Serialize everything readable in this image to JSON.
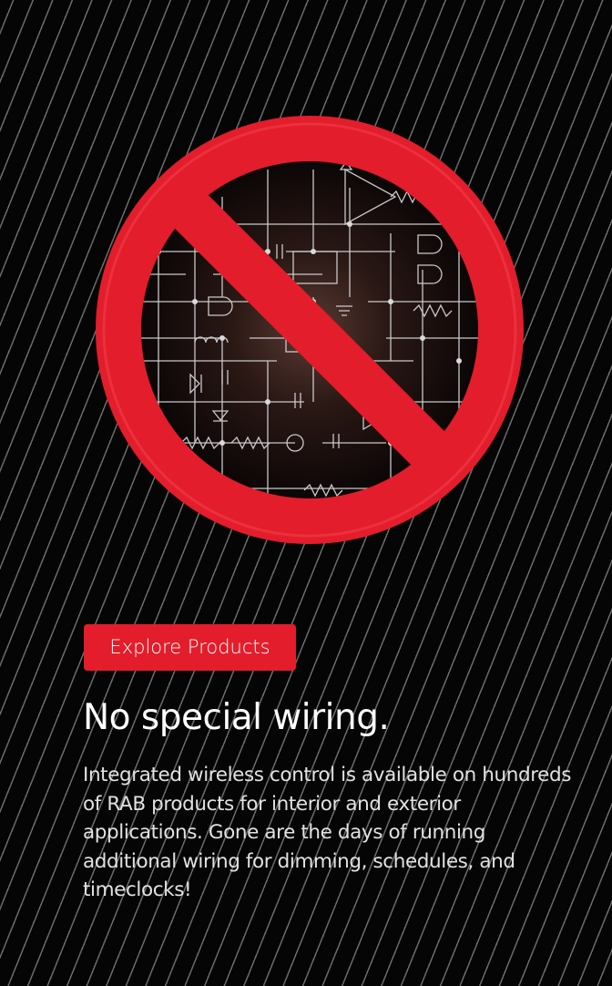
{
  "hero": {
    "image": "no-special-wiring-prohibition-icon",
    "description_icon": "circuit-diagram-icon"
  },
  "cta": {
    "label": "Explore Products"
  },
  "headline": "No special wiring.",
  "body": "Integrated wireless control is available on hundreds of RAB products for interior and exterior applications. Gone are the days of running additional wiring for dimming, schedules, and timeclocks!",
  "colors": {
    "accent": "#e31d2b",
    "background": "#050505",
    "stripe": "#6a6a6a",
    "text": "#ffffff"
  }
}
